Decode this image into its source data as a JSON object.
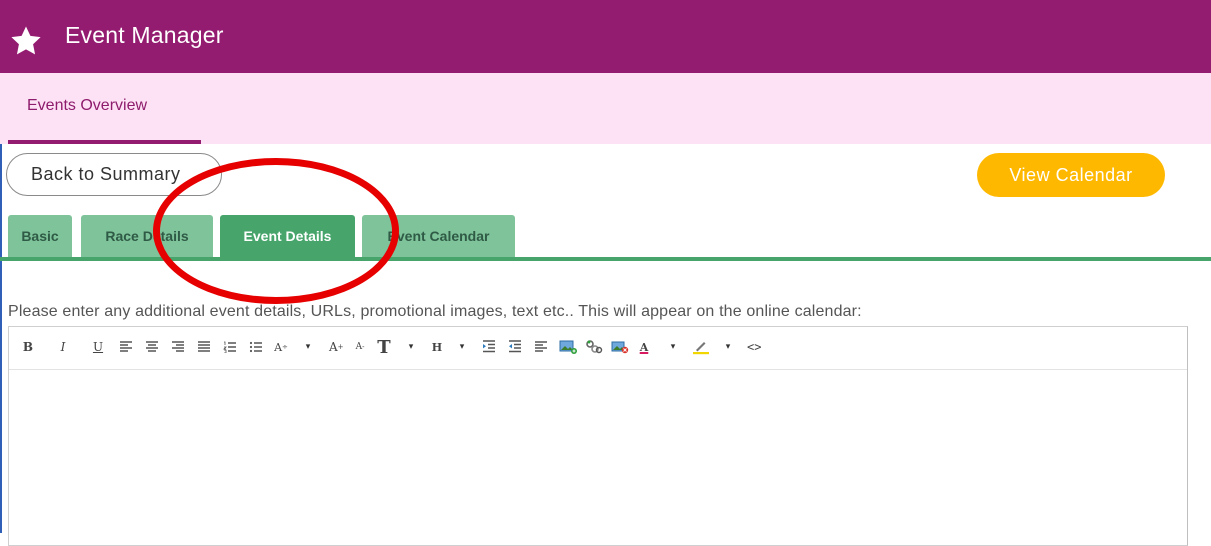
{
  "header": {
    "title": "Event Manager",
    "icon": "star-icon"
  },
  "nav": {
    "tab_label": "Events Overview"
  },
  "actions": {
    "back_label": "Back to Summary",
    "calendar_label": "View Calendar"
  },
  "tabs": [
    {
      "label": "Basic",
      "active": false
    },
    {
      "label": "Race Details",
      "active": false
    },
    {
      "label": "Event Details",
      "active": true
    },
    {
      "label": "Event Calendar",
      "active": false
    }
  ],
  "instructions": "Please enter any additional event details, URLs, promotional images, text etc.. This will appear on the online calendar:",
  "toolbar": {
    "bold": "B",
    "italic": "I",
    "underline": "U",
    "font_size": "A",
    "font_size_up": "A",
    "font_size_down": "A",
    "font_family": "T",
    "heading": "H",
    "font_color": "A",
    "code": "<>",
    "caret": "▾"
  },
  "colors": {
    "header": "#941c70",
    "nav_bg": "#fde2f6",
    "accent": "#ffb800",
    "tab": "#7fc39a",
    "tab_active": "#47a56c",
    "annotation": "#e60000"
  }
}
